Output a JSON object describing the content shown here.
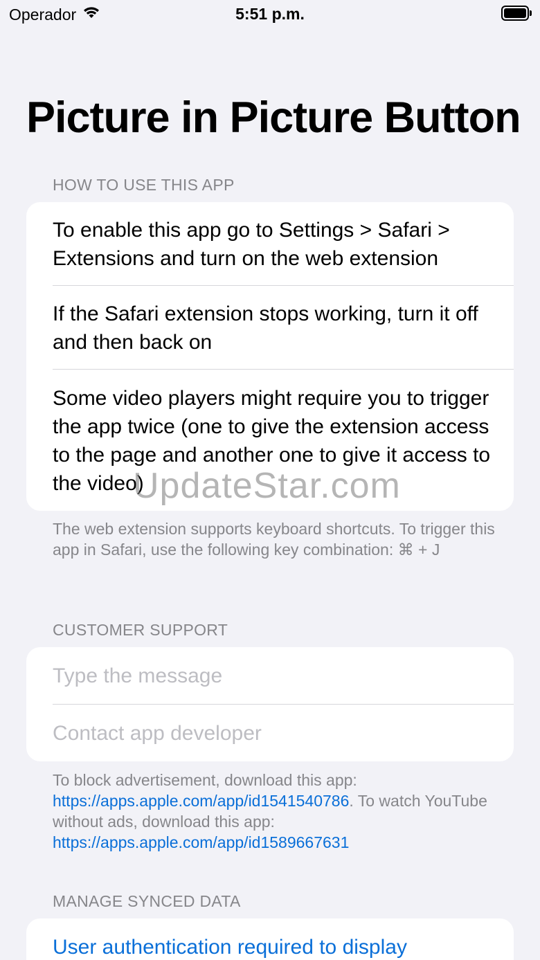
{
  "status_bar": {
    "carrier": "Operador",
    "time": "5:51 p.m."
  },
  "title": "Picture in Picture Button",
  "how_to": {
    "header": "HOW TO USE THIS APP",
    "rows": [
      "To enable this app go to Settings > Safari > Extensions and turn on the web extension",
      "If the Safari extension stops working, turn it off and then back on",
      "Some video players might require you to trigger the app twice (one to give the extension access to the page and another one to give it access to the video)"
    ],
    "footer": "The web extension supports keyboard shortcuts. To trigger this app in Safari, use the following key combination: ⌘ + J"
  },
  "support": {
    "header": "CUSTOMER SUPPORT",
    "message_placeholder": "Type the message",
    "contact_placeholder": "Contact app developer",
    "footer_part1": "To block advertisement, download this app: ",
    "footer_link1": "https://apps.apple.com/app/id1541540786",
    "footer_part2": ". To watch YouTube without ads, download this app: ",
    "footer_link2": "https://apps.apple.com/app/id1589667631"
  },
  "synced": {
    "header": "MANAGE SYNCED DATA",
    "auth_row": "User authentication required to display"
  },
  "watermark": "UpdateStar.com",
  "colors": {
    "background": "#f2f2f7",
    "link": "#0a6fd8",
    "secondary_text": "#86868a",
    "placeholder": "#bdbdc2"
  }
}
